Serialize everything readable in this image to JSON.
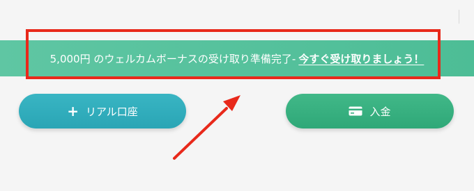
{
  "banner": {
    "message": "5,000円 のウェルカムボーナスの受け取り準備完了-",
    "link_label": "今すぐ受け取りましょう！"
  },
  "buttons": {
    "real_account_label": "リアル口座",
    "deposit_label": "入金"
  },
  "icons": {
    "real_account": "plus-icon",
    "deposit": "credit-card-icon"
  },
  "colors": {
    "banner": "#4dbd96",
    "real_account_button": "#2ea9b8",
    "deposit_button": "#36ae7e",
    "annotation": "#e8291b"
  }
}
